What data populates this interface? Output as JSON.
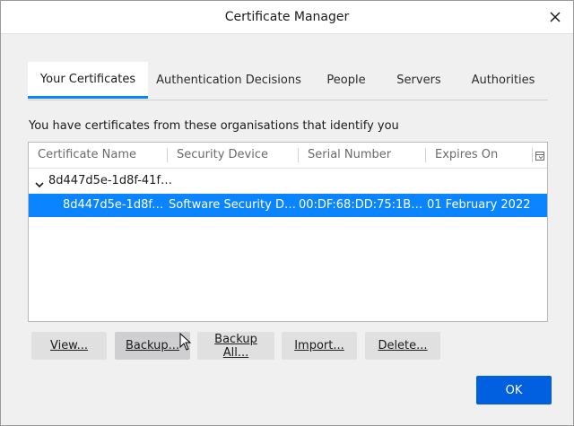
{
  "window": {
    "title": "Certificate Manager",
    "close_glyph": "✕"
  },
  "tabs": [
    {
      "label": "Your Certificates",
      "selected": true
    },
    {
      "label": "Authentication Decisions",
      "selected": false
    },
    {
      "label": "People",
      "selected": false
    },
    {
      "label": "Servers",
      "selected": false
    },
    {
      "label": "Authorities",
      "selected": false
    }
  ],
  "description": "You have certificates from these organisations that identify you",
  "tree": {
    "columns": [
      "Certificate Name",
      "Security Device",
      "Serial Number",
      "Expires On"
    ],
    "group": {
      "name": "8d447d5e-1d8f-41f0..."
    },
    "rows": [
      {
        "certificate_name": "8d447d5e-1d8f-4...",
        "security_device": "Software Security Devi...",
        "serial_number": "00:DF:68:DD:75:1B:BD:...",
        "expires_on": "01 February 2022",
        "selected": true
      }
    ]
  },
  "buttons": {
    "view": "View...",
    "backup": "Backup...",
    "backup_all": "Backup All...",
    "import": "Import...",
    "delete": "Delete...",
    "ok": "OK"
  },
  "colors": {
    "accent": "#0a84ff",
    "ok_button": "#0060df",
    "button": "#e0e0e0"
  }
}
